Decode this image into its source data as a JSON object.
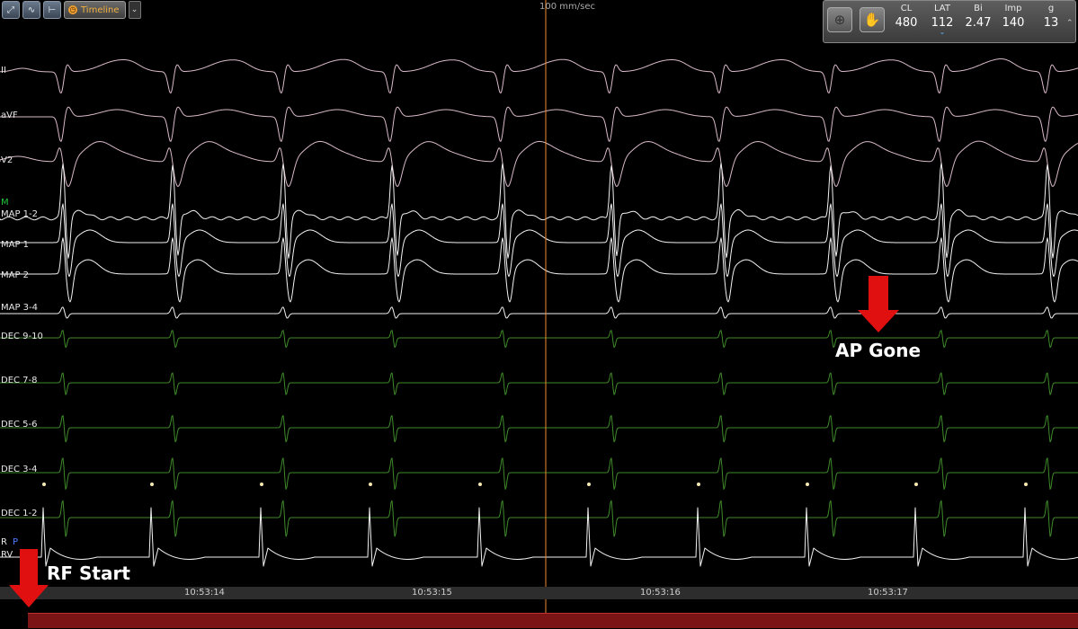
{
  "toolbar": {
    "timeline_label": "Timeline"
  },
  "sweep_speed": "100 mm/sec",
  "metrics": [
    {
      "key": "CL",
      "value": "480"
    },
    {
      "key": "LAT",
      "value": "112"
    },
    {
      "key": "Bi",
      "value": "2.47"
    },
    {
      "key": "Imp",
      "value": "140"
    },
    {
      "key": "g",
      "value": "13"
    }
  ],
  "channels": {
    "ii": "II",
    "avf": "aVF",
    "v2": "V2",
    "m": "M",
    "map12": "MAP 1-2",
    "map1": "MAP 1",
    "map2": "MAP 2",
    "map34": "MAP 3-4",
    "dec910": "DEC 9-10",
    "dec78": "DEC 7-8",
    "dec56": "DEC 5-6",
    "dec34": "DEC 3-4",
    "dec12": "DEC 1-2",
    "r": "R",
    "p": "P",
    "rv": "RV"
  },
  "time_axis": [
    "10:53:14",
    "10:53:15",
    "10:53:16",
    "10:53:17"
  ],
  "annotations": {
    "ap_gone": "AP Gone",
    "rf_start": "RF Start"
  },
  "colors": {
    "surface_ecg": "#d8b8c8",
    "map_trace": "#f2f2f2",
    "dec_trace": "#3f8a2a",
    "rv_trace": "#f2f2f2",
    "cursor": "#f08a30",
    "arrow": "#e01010",
    "rf_bar": "#7b1515"
  }
}
